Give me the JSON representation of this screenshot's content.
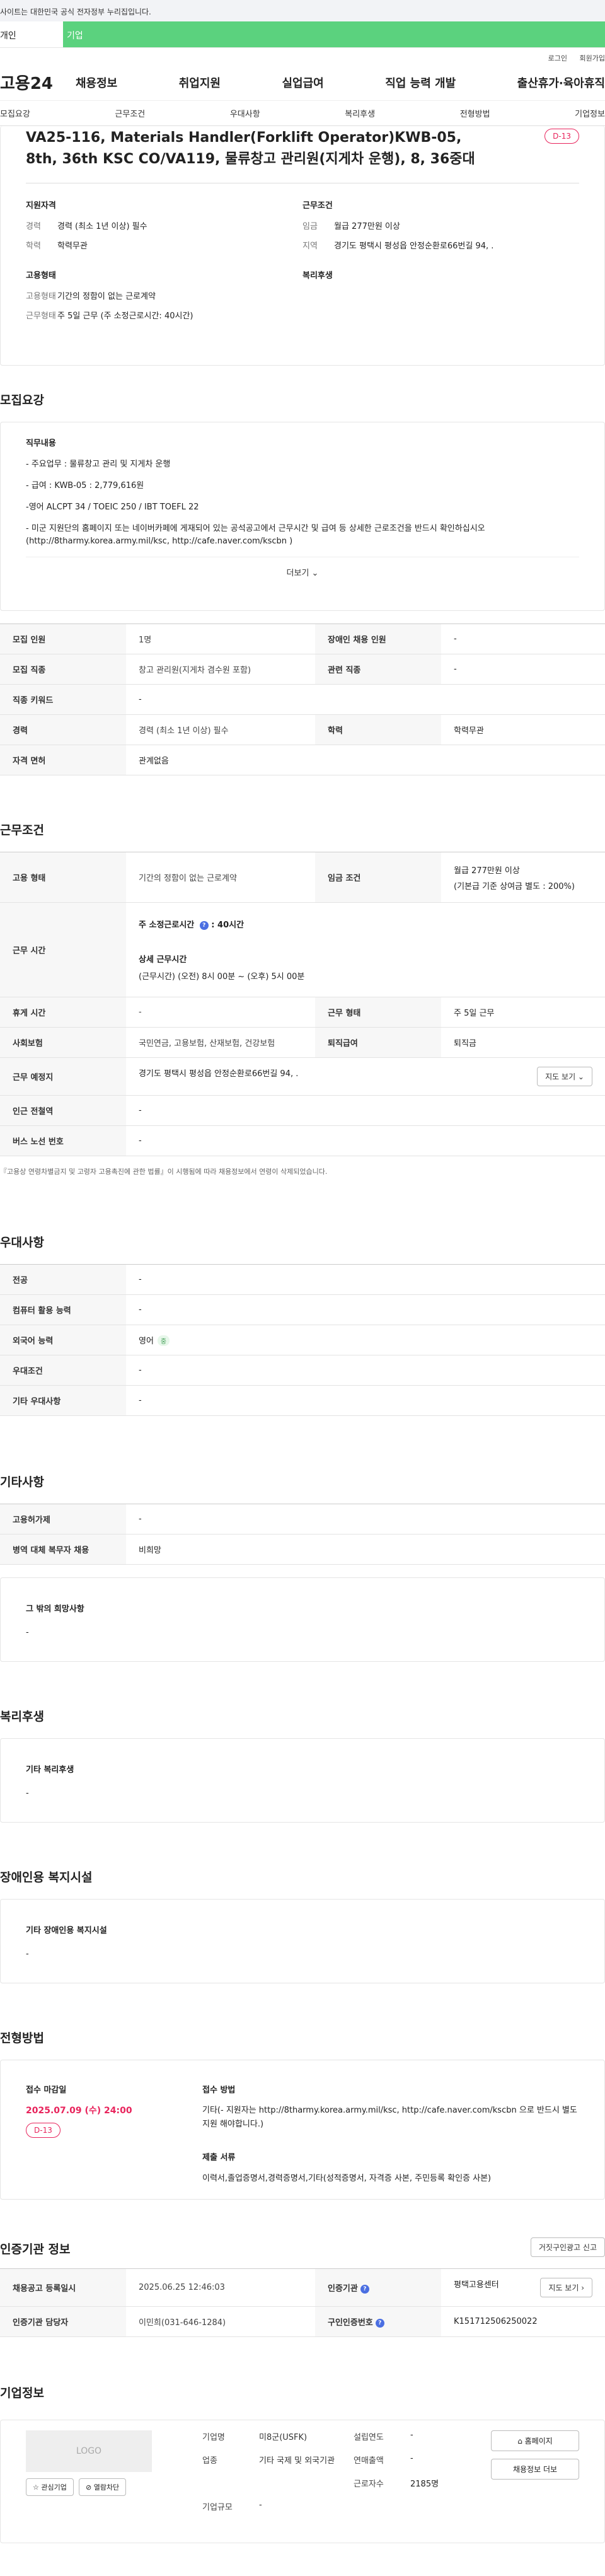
{
  "gov_banner": "사이트는 대한민국 공식 전자정부 누리집입니다.",
  "user_tabs": [
    "개인",
    "기업"
  ],
  "util": {
    "login": "로그인",
    "join": "회원가입"
  },
  "logo": "고용24",
  "gnb": [
    "채용정보",
    "취업지원",
    "실업급여",
    "직업 능력 개발",
    "출산휴가·육아휴직"
  ],
  "subnav": [
    "모집요강",
    "근무조건",
    "우대사항",
    "복리후생",
    "전형방법",
    "기업정보"
  ],
  "summary": {
    "title": "VA25-116, Materials Handler(Forklift Operator)KWB-05, 8th, 36th KSC CO/VA119, 물류창고 관리원(지게차 운행), 8, 36중대",
    "dday": "D-13",
    "qual_h": "지원자격",
    "cond_h": "근무조건",
    "career_k": "경력",
    "career_v": "경력 (최소 1년 이상) 필수",
    "edu_k": "학력",
    "edu_v": "학력무관",
    "wage_k": "임금",
    "wage_v": "월급 277만원 이상",
    "region_k": "지역",
    "region_v": "경기도 평택시 평성읍 안정순환로66번길 94, .",
    "emp_h": "고용형태",
    "welfare_h": "복리후생",
    "emptype_k": "고용형태",
    "emptype_v": "기간의 정함이 없는 근로계약",
    "worktype_k": "근무형태",
    "worktype_v": "주 5일 근무 (주 소정근로시간: 40시간)"
  },
  "recruit": {
    "title": "모집요강",
    "job_h": "직무내용",
    "lines": [
      "- 주요업무 : 물류창고 관리 및 지게차 운행",
      "- 급여 : KWB-05 : 2,779,616원",
      "-영어 ALCPT 34 / TOEIC 250 / IBT TOEFL 22",
      "- 미군 지원단의 홈페이지 또는 네이버카페에 게재되어 있는 공석공고에서 근무시간 및 급여 등 상세한 근로조건을 반드시 확인하십시오 (http://8tharmy.korea.army.mil/ksc, http://cafe.naver.com/kscbn )"
    ],
    "more": "더보기 ⌄",
    "rows": [
      [
        "모집 인원",
        "1명",
        "장애인 채용 인원",
        "-"
      ],
      [
        "모집 직종",
        "창고 관리원(지게차 겸수원 포함)",
        "관련 직종",
        "-"
      ],
      [
        "직종 키워드",
        "-"
      ],
      [
        "경력",
        "경력 (최소 1년 이상) 필수",
        "학력",
        "학력무관"
      ],
      [
        "자격 면허",
        "관계없음"
      ]
    ]
  },
  "work": {
    "title": "근무조건",
    "emp_k": "고용 형태",
    "emp_v": "기간의 정함이 없는 근로계약",
    "wage_k": "임금 조건",
    "wage_v1": "월급 277만원 이상",
    "wage_v2": "(기본급 기준 상여금 별도 : 200%)",
    "time_k": "근무 시간",
    "time_std": "주 소정근로시간",
    "time_hours": "40시간",
    "time_detail_h": "상세 근무시간",
    "time_detail": "(근무시간) (오전) 8시 00분 ~ (오후) 5시 00분",
    "holiday_k": "휴게 시간",
    "holiday_v": "-",
    "form_k": "근무 형태",
    "form_v": "주 5일 근무",
    "ins_k": "사회보험",
    "ins_v": "국민연금, 고용보험, 산재보험, 건강보험",
    "retire_k": "퇴직급여",
    "retire_v": "퇴직금",
    "place_k": "근무 예정지",
    "place_v": "경기도 평택시 평성읍 안정순환로66번길 94, .",
    "map_btn": "지도 보기 ⌄",
    "station_k": "인근 전철역",
    "station_v": "-",
    "bus_k": "버스 노선 번호",
    "bus_v": "-",
    "note": "『고용상 연령차별금지 및 고령자 고용촉진에 관한 법률』이 시행됨에 따라 채용정보에서 연령이 삭제되었습니다."
  },
  "pref": {
    "title": "우대사항",
    "rows": [
      [
        "전공",
        "-"
      ],
      [
        "컴퓨터 활용 능력",
        "-"
      ],
      [
        "외국어 능력",
        "영어"
      ],
      [
        "우대조건",
        "-"
      ],
      [
        "기타 우대사항",
        "-"
      ]
    ],
    "lang_tag": "중"
  },
  "etc": {
    "title": "기타사항",
    "rows": [
      [
        "고용허가제",
        "-"
      ],
      [
        "병역 대체 복무자 채용",
        "비희망"
      ]
    ],
    "other_h": "그 밖의 희망사항",
    "other_v": "-"
  },
  "welfare": {
    "title": "복리후생",
    "h": "기타 복리후생",
    "v": "-"
  },
  "disabled": {
    "title": "장애인용 복지시설",
    "h": "기타 장애인용 복지시설",
    "v": "-"
  },
  "apply": {
    "title": "전형방법",
    "deadline_h": "접수 마감일",
    "deadline": "2025.07.09 (수) 24:00",
    "dday": "D-13",
    "method_h": "접수 방법",
    "method_v": "기타(- 지원자는 http://8tharmy.korea.army.mil/ksc, http://cafe.naver.com/kscbn 으로 반드시 별도 지원 해야합니다.)",
    "docs_h": "제출 서류",
    "docs_v": "이력서,졸업증명서,경력증명서,기타(성적증명서, 자격증 사본, 주민등록 확인증 사본)"
  },
  "cert": {
    "title": "인증기관 정보",
    "report_btn": "거짓구인광고 신고",
    "reg_k": "채용공고 등록일시",
    "reg_v": "2025.06.25 12:46:03",
    "org_k": "인증기관",
    "org_v": "평택고용센터",
    "map_btn": "지도 보기 ›",
    "mgr_k": "인증기관 담당자",
    "mgr_v": "이민희(031-646-1284)",
    "no_k": "구인인증번호",
    "no_v": "K151712506250022"
  },
  "company": {
    "title": "기업정보",
    "logo": "LOGO",
    "fav_btn": "☆ 관심기업",
    "block_btn": "⊘ 열람차단",
    "name_k": "기업명",
    "name_v": "미8군(USFK)",
    "year_k": "설립연도",
    "year_v": "-",
    "ind_k": "업종",
    "ind_v": "기타 국제 및 외국기관",
    "sales_k": "연매출액",
    "sales_v": "-",
    "emp_k": "근로자수",
    "emp_v": "2185명",
    "size_k": "기업규모",
    "size_v": "-",
    "home_btn": "⌂ 홈페이지",
    "recruit_btn": "채용정보 더보",
    "brand_color": "#5bd27e",
    "accent_color": "#e8245c"
  }
}
